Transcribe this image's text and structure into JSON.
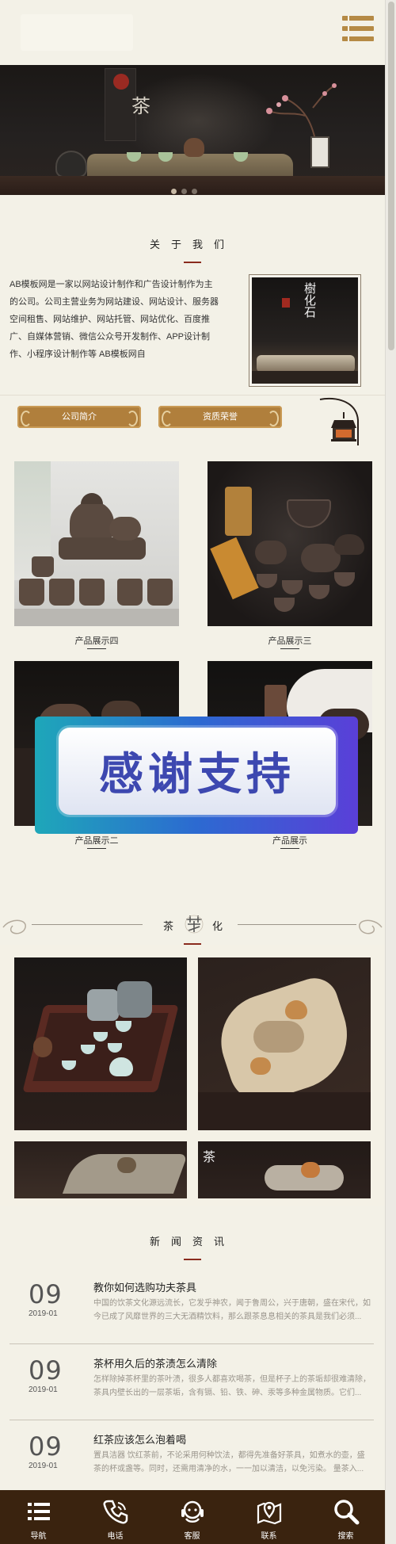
{
  "header": {
    "menu_icon": "menu-list-icon"
  },
  "about": {
    "title": "关于我们",
    "text": "AB模板网是一家以网站设计制作和广告设计制作为主的公司。公司主营业务为网站建设、网站设计、服务器空间租售、网站维护、网站托管、网站优化、百度推广、自媒体营销、微信公众号开发制作、APP设计制作、小程序设计制作等 AB模板网自",
    "image_text": "樹化石",
    "btn_intro": "公司简介",
    "btn_honor": "资质荣誉"
  },
  "products": [
    {
      "caption": "产品展示四"
    },
    {
      "caption": "产品展示三"
    },
    {
      "caption": "产品展示二"
    },
    {
      "caption": "产品展示"
    }
  ],
  "overlay": {
    "text": "感谢支持"
  },
  "culture": {
    "title_left": "茶",
    "title_right": "化"
  },
  "news": {
    "title": "新闻资讯",
    "items": [
      {
        "day": "09",
        "date": "2019-01",
        "title": "教你如何选购功夫茶具",
        "desc": "中国的饮茶文化源远流长，它发乎神农，闻于鲁周公，兴于唐朝，盛在宋代，如今已成了风靡世界的三大无酒精饮料，那么跟茶息息相关的茶具是我们必须..."
      },
      {
        "day": "09",
        "date": "2019-01",
        "title": "茶杯用久后的茶渍怎么清除",
        "desc": "怎样除掉茶杯里的茶叶渍，很多人都喜欢喝茶，但是杯子上的茶垢却很难清除，茶具内壁长出的一层茶垢，含有镉、铅、铁、砷、汞等多种金属物质。它们..."
      },
      {
        "day": "09",
        "date": "2019-01",
        "title": "红茶应该怎么泡着喝",
        "desc": "置具洁器 饮红茶前，不论采用何种饮法，都得先准备好茶具，如煮水的壶，盛茶的杯或盏等。同时，还需用清净的水，一一加以清洁，以免污染。 量茶入..."
      }
    ]
  },
  "bottom_nav": [
    {
      "label": "导航",
      "icon": "menu-icon"
    },
    {
      "label": "电话",
      "icon": "phone-icon"
    },
    {
      "label": "客服",
      "icon": "customer-service-icon"
    },
    {
      "label": "联系",
      "icon": "map-pin-icon"
    },
    {
      "label": "搜索",
      "icon": "search-icon"
    }
  ],
  "colors": {
    "background": "#f3f1e7",
    "accent_gold": "#b07f3c",
    "accent_red": "#8a2b1e",
    "nav_bg": "#3a230f"
  }
}
